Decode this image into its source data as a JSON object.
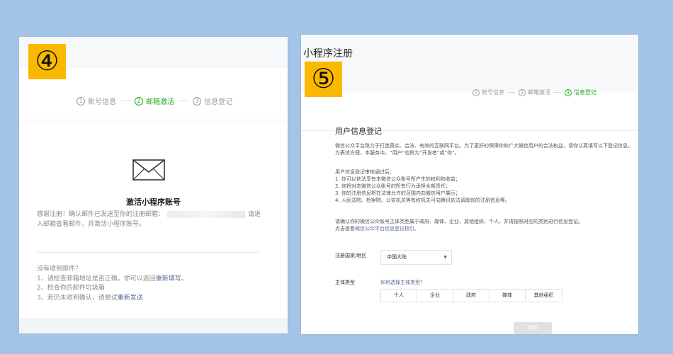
{
  "left_panel": {
    "step_badge": "④",
    "steps": [
      {
        "num": "1",
        "label": "账号信息",
        "active": false
      },
      {
        "num": "2",
        "label": "邮箱激活",
        "active": true
      },
      {
        "num": "3",
        "label": "信息登记",
        "active": false
      }
    ],
    "envelope_icon": "envelope-icon",
    "title": "激活小程序账号",
    "thanks_before": "感谢注册！确认邮件已发送至你的注册邮箱：",
    "thanks_after": "请进",
    "thanks_line2": "入邮箱查看邮件，并激活小程序账号。",
    "help_title": "没有收到邮件？",
    "help_1": "1、请检查邮箱地址是否正确，你可以返回",
    "help_1_link": "重新填写。",
    "help_2": "2、检查你的邮件垃圾箱",
    "help_3": "3、若仍未收到确认，请尝试",
    "help_3_link": "重新发送"
  },
  "right_panel": {
    "page_title": "小程序注册",
    "step_badge": "⑤",
    "steps": [
      {
        "num": "1",
        "label": "账号信息",
        "active": false
      },
      {
        "num": "2",
        "label": "邮箱激活",
        "active": false
      },
      {
        "num": "3",
        "label": "信息登记",
        "active": true
      }
    ],
    "form_title": "用户信息登记",
    "intro_1": "微信公众平台致力于打造真实、合法、有效的互联网平台。为了更好的保障你和广大微信用户的合法权益，请你认真填写以下登记信息。",
    "intro_2": "为表述方便，本服务中，“用户”也称为“开发者”或“你”。",
    "review_title": "用户信息登记审核通过后：",
    "review_1": "1. 你可以依法享有本微信公众账号所产生的权利和收益；",
    "review_2": "2. 你将对本微信公众账号的所有行为承担全部责任；",
    "review_3": "3. 你的注册信息将在法律允许的范围内向微信用户展示；",
    "review_4": "4. 人民法院、检察院、公安机关等有权机关可向腾讯依法调取你的注册信息等。",
    "confirm_1": "请确认你的微信公众账号主体类型属于政府、媒体、企业、其他组织、个人，并请按照对应的类别进行信息登记。",
    "confirm_2_before": "点击查看",
    "confirm_2_link": "微信公众平台信息登记指引",
    "confirm_2_after": "。",
    "country_label": "注册国家/地区",
    "country_value": "中国大陆",
    "subject_label": "主体类型",
    "how_link": "如何选择主体类型?",
    "subject_types": [
      "个人",
      "企业",
      "政府",
      "媒体",
      "其他组织"
    ],
    "continue_label": "继续"
  },
  "colors": {
    "accent_green": "#1aad19",
    "link_blue": "#576b95",
    "badge_yellow": "#fbb800",
    "background_blue": "#a3c4e6"
  }
}
